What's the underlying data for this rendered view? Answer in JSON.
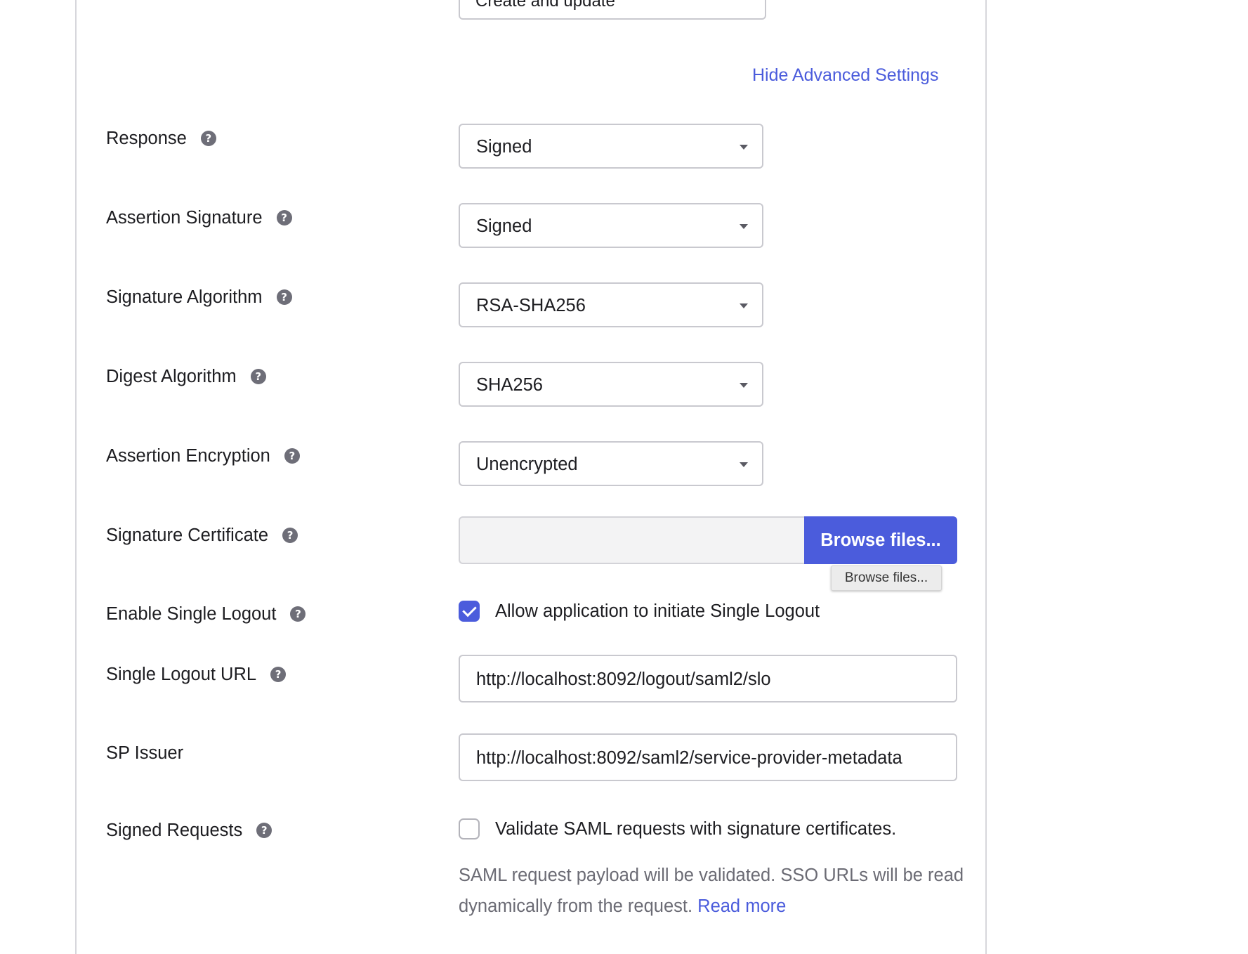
{
  "top_select": {
    "value": "Create and update"
  },
  "advanced_link": "Hide Advanced Settings",
  "rows": {
    "response": {
      "label": "Response",
      "value": "Signed"
    },
    "assertion_signature": {
      "label": "Assertion Signature",
      "value": "Signed"
    },
    "signature_algorithm": {
      "label": "Signature Algorithm",
      "value": "RSA-SHA256"
    },
    "digest_algorithm": {
      "label": "Digest Algorithm",
      "value": "SHA256"
    },
    "assertion_encryption": {
      "label": "Assertion Encryption",
      "value": "Unencrypted"
    },
    "signature_certificate": {
      "label": "Signature Certificate",
      "button": "Browse files...",
      "tooltip": "Browse files..."
    },
    "single_logout": {
      "label": "Enable Single Logout",
      "checkbox_label": "Allow application to initiate Single Logout",
      "checked": true
    },
    "single_logout_url": {
      "label": "Single Logout URL",
      "value": "http://localhost:8092/logout/saml2/slo"
    },
    "sp_issuer": {
      "label": "SP Issuer",
      "value": "http://localhost:8092/saml2/service-provider-metadata"
    },
    "signed_requests": {
      "label": "Signed Requests",
      "checkbox_label": "Validate SAML requests with signature certificates.",
      "checked": false,
      "hint": "SAML request payload will be validated. SSO URLs will be read dynamically from the request.",
      "read_more": "Read more"
    }
  },
  "help_glyph": "?",
  "colors": {
    "accent": "#4b5cdc",
    "help_icon": "#6e6e78",
    "border": "#c9c9cf"
  }
}
